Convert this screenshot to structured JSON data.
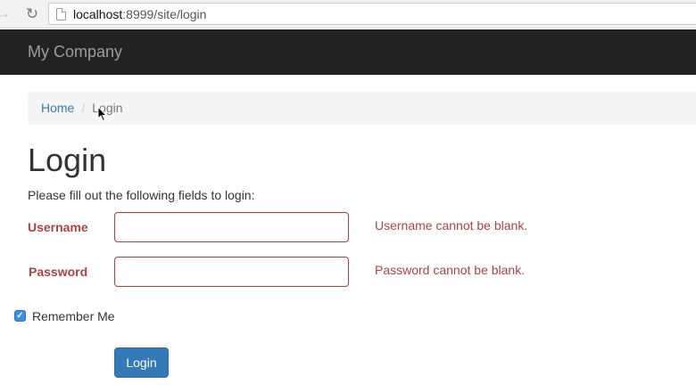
{
  "browser": {
    "url_host": "localhost",
    "url_rest": ":8999/site/login"
  },
  "navbar": {
    "brand": "My Company"
  },
  "breadcrumb": {
    "home": "Home",
    "separator": "/",
    "current": "Login"
  },
  "page": {
    "title": "Login",
    "instructions": "Please fill out the following fields to login:"
  },
  "form": {
    "username": {
      "label": "Username",
      "value": "",
      "error": "Username cannot be blank."
    },
    "password": {
      "label": "Password",
      "value": "",
      "error": "Password cannot be blank."
    },
    "remember_me": {
      "label": "Remember Me",
      "checked": true
    },
    "submit_label": "Login"
  },
  "colors": {
    "error": "#a94442",
    "primary": "#337ab7",
    "navbar": "#222222",
    "link": "#337ab7"
  }
}
